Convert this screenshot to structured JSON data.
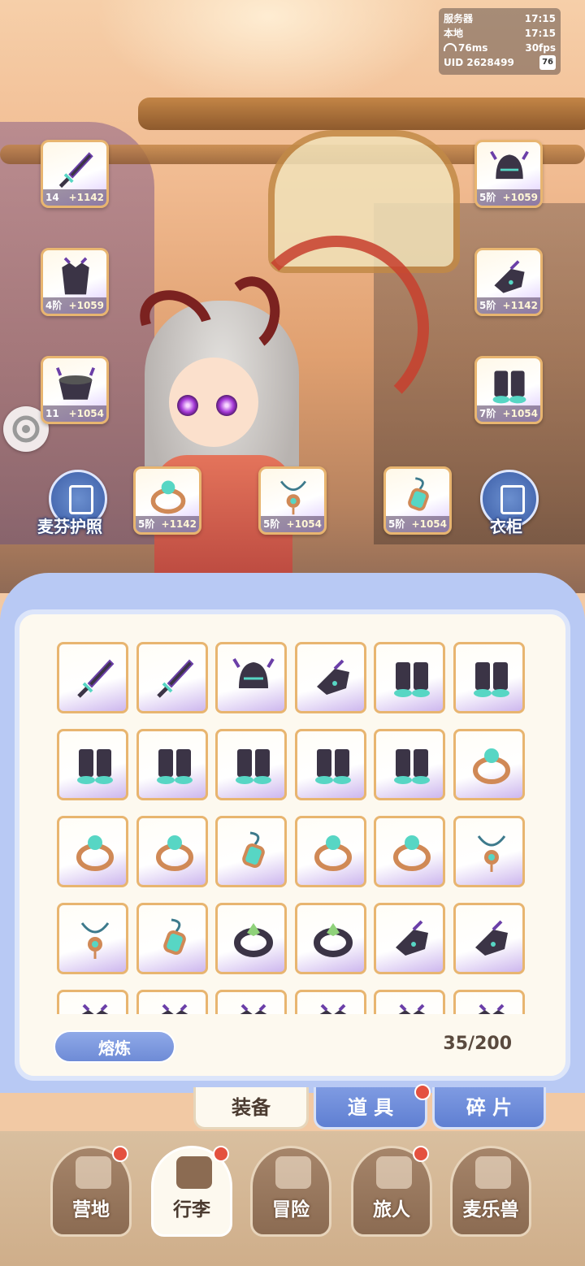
{
  "status": {
    "server_label": "服务器",
    "server_time": "17:15",
    "local_label": "本地",
    "local_time": "17:15",
    "ping": "76ms",
    "fps": "30fps",
    "uid": "UID 2628499",
    "battery": "76"
  },
  "equipped": [
    {
      "id": "weapon",
      "icon": "sword-icon",
      "tier": "14阶",
      "bonus": "+1142"
    },
    {
      "id": "helmet",
      "icon": "helmet-icon",
      "tier": "5阶",
      "bonus": "+1059"
    },
    {
      "id": "armor",
      "icon": "armor-icon",
      "tier": "4阶",
      "bonus": "+1059"
    },
    {
      "id": "gauntlet",
      "icon": "gauntlet-icon",
      "tier": "5阶",
      "bonus": "+1142"
    },
    {
      "id": "belt",
      "icon": "belt-icon",
      "tier": "11阶",
      "bonus": "+1054"
    },
    {
      "id": "boots",
      "icon": "boots-icon",
      "tier": "7阶",
      "bonus": "+1054"
    },
    {
      "id": "ring",
      "icon": "ring-icon",
      "tier": "5阶",
      "bonus": "+1142"
    },
    {
      "id": "necklace",
      "icon": "necklace-icon",
      "tier": "5阶",
      "bonus": "+1054"
    },
    {
      "id": "amulet",
      "icon": "amulet-icon",
      "tier": "5阶",
      "bonus": "+1054"
    }
  ],
  "buttons": {
    "passport": "麦芬护照",
    "wardrobe": "衣柜",
    "smelt": "熔炼"
  },
  "inventory": {
    "capacity": "35/200",
    "items": [
      "sword-icon",
      "sword-icon",
      "helmet-icon",
      "gauntlet-icon",
      "boots-icon",
      "boots-icon",
      "boots-icon",
      "boots-icon",
      "boots-icon",
      "boots-icon",
      "boots-icon",
      "ring-icon",
      "ring-icon",
      "ring-icon",
      "amulet-icon",
      "ring-icon",
      "ring-icon",
      "necklace-icon",
      "necklace-icon",
      "amulet-icon",
      "dark-ring-icon",
      "dark-ring-icon",
      "gauntlet-icon",
      "gauntlet-icon",
      "armor-icon",
      "armor-icon",
      "armor-icon",
      "armor-icon",
      "armor-icon",
      "armor-icon"
    ]
  },
  "tabs": [
    {
      "label": "装备",
      "active": true,
      "badge": false
    },
    {
      "label": "道 具",
      "active": false,
      "badge": true
    },
    {
      "label": "碎 片",
      "active": false,
      "badge": false
    }
  ],
  "nav": [
    {
      "label": "营地",
      "icon": "castle-icon",
      "active": false,
      "badge": true
    },
    {
      "label": "行李",
      "icon": "bag-icon",
      "active": true,
      "badge": true
    },
    {
      "label": "冒险",
      "icon": "crossed-swords-icon",
      "active": false,
      "badge": false
    },
    {
      "label": "旅人",
      "icon": "traveler-icon",
      "active": false,
      "badge": true
    },
    {
      "label": "麦乐兽",
      "icon": "pet-icon",
      "active": false,
      "badge": false
    }
  ],
  "colors": {
    "panel_blue": "#b8c9f4",
    "item_border": "#e8b570",
    "badge_red": "#e4513f"
  }
}
